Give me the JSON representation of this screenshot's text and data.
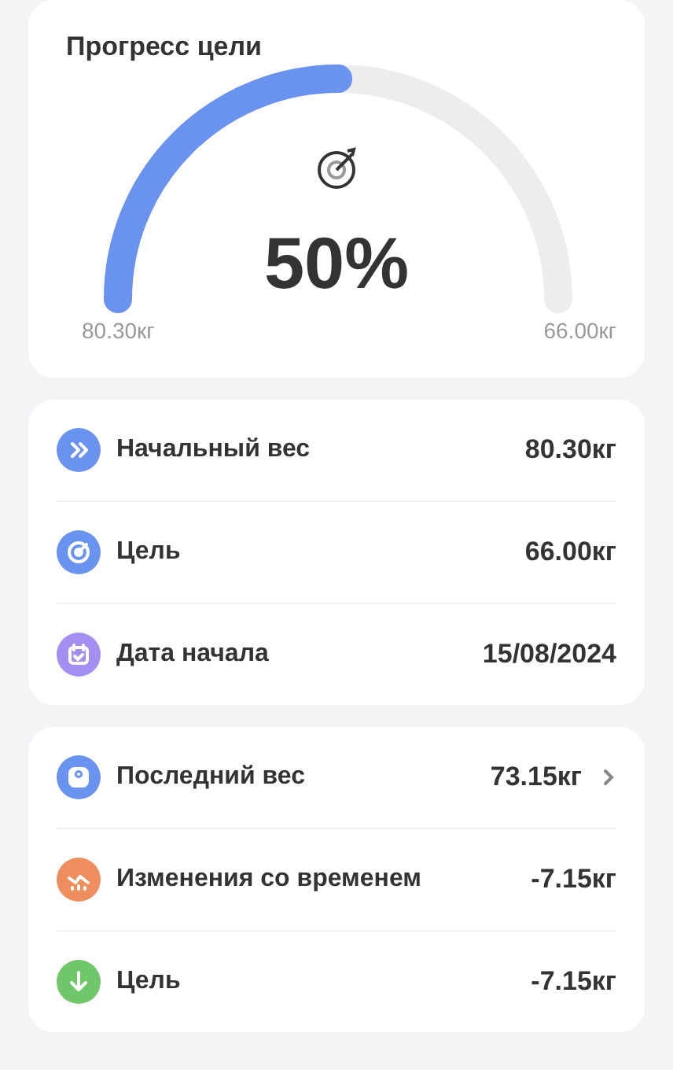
{
  "progress": {
    "title": "Прогресс цели",
    "percent": "50%",
    "start_label": "80.30кг",
    "end_label": "66.00кг"
  },
  "sections": [
    {
      "rows": [
        {
          "kind": "start",
          "color": "#6a93ef",
          "label": "Начальный вес",
          "value": "80.30кг",
          "chevron": false
        },
        {
          "kind": "goal",
          "color": "#6a93ef",
          "label": "Цель",
          "value": "66.00кг",
          "chevron": false
        },
        {
          "kind": "date",
          "color": "#a28ff0",
          "label": "Дата начала",
          "value": "15/08/2024",
          "chevron": false
        }
      ]
    },
    {
      "rows": [
        {
          "kind": "scale",
          "color": "#6a93ef",
          "label": "Последний вес",
          "value": "73.15кг",
          "chevron": true
        },
        {
          "kind": "trend",
          "color": "#ee8e5f",
          "label": "Изменения со временем",
          "value": "-7.15кг",
          "chevron": false
        },
        {
          "kind": "down",
          "color": "#6fc76a",
          "label": "Цель",
          "value": "-7.15кг",
          "chevron": false
        }
      ]
    }
  ]
}
